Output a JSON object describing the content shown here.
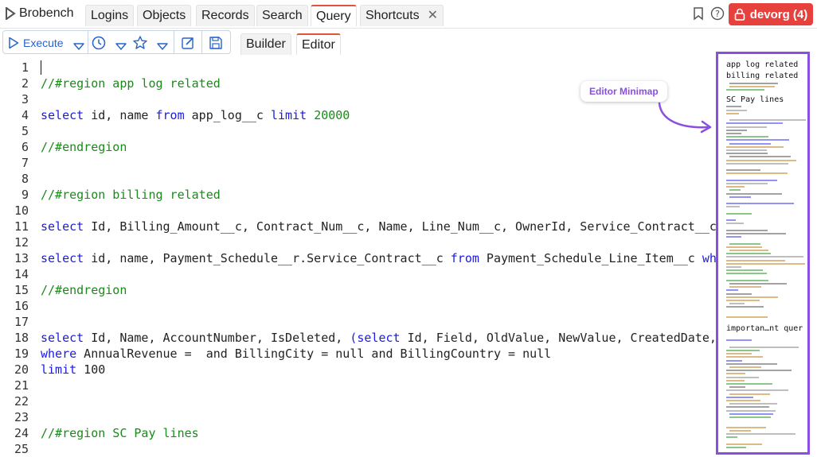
{
  "app": {
    "name": "Brobench"
  },
  "nav_tabs": [
    {
      "label": "Logins",
      "active": false
    },
    {
      "label": "Objects",
      "active": false
    },
    {
      "label": "Records",
      "active": false
    },
    {
      "label": "Search",
      "active": false
    },
    {
      "label": "Query",
      "active": true
    },
    {
      "label": "Shortcuts",
      "active": false,
      "closable": true
    }
  ],
  "header_icons": [
    "bookmark-icon",
    "help-icon"
  ],
  "org_button": {
    "label": "devorg (4)",
    "icon": "lock-icon",
    "color": "#e6413c"
  },
  "toolbar": {
    "execute_label": "Execute",
    "icons": [
      "play-icon",
      "chevron-down-icon",
      "history-icon",
      "chevron-down-icon",
      "star-icon",
      "chevron-down-icon",
      "edit-icon",
      "save-icon"
    ]
  },
  "sub_tabs": [
    {
      "label": "Builder",
      "active": false
    },
    {
      "label": "Editor",
      "active": true
    }
  ],
  "editor": {
    "line_numbers": [
      "1",
      "2",
      "3",
      "4",
      "5",
      "6",
      "7",
      "8",
      "9",
      "10",
      "11",
      "12",
      "13",
      "14",
      "15",
      "16",
      "17",
      "18",
      "19",
      "20",
      "21",
      "22",
      "23",
      "24",
      "25"
    ],
    "lines": [
      {
        "n": 1,
        "tokens": []
      },
      {
        "n": 2,
        "tokens": [
          {
            "t": "//#region app log related",
            "c": "cm"
          }
        ]
      },
      {
        "n": 3,
        "tokens": []
      },
      {
        "n": 4,
        "tokens": [
          {
            "t": "select",
            "c": "kw"
          },
          {
            "t": " id, name ",
            "c": ""
          },
          {
            "t": "from",
            "c": "kw"
          },
          {
            "t": " app_log__c ",
            "c": ""
          },
          {
            "t": "limit",
            "c": "kw"
          },
          {
            "t": " ",
            "c": ""
          },
          {
            "t": "20000",
            "c": "num"
          }
        ]
      },
      {
        "n": 5,
        "tokens": []
      },
      {
        "n": 6,
        "tokens": [
          {
            "t": "//#endregion",
            "c": "cm"
          }
        ]
      },
      {
        "n": 7,
        "tokens": []
      },
      {
        "n": 8,
        "tokens": []
      },
      {
        "n": 9,
        "tokens": [
          {
            "t": "//#region billing related",
            "c": "cm"
          }
        ]
      },
      {
        "n": 10,
        "tokens": []
      },
      {
        "n": 11,
        "tokens": [
          {
            "t": "select",
            "c": "kw"
          },
          {
            "t": " Id, Billing_Amount__c, Contract_Num__c, Name, Line_Num__c, OwnerId, Service_Contract__c,",
            "c": ""
          }
        ]
      },
      {
        "n": 12,
        "tokens": []
      },
      {
        "n": 13,
        "tokens": [
          {
            "t": "select",
            "c": "kw"
          },
          {
            "t": " id, name, Payment_Schedule__r.Service_Contract__c ",
            "c": ""
          },
          {
            "t": "from",
            "c": "kw"
          },
          {
            "t": " Payment_Schedule_Line_Item__c ",
            "c": ""
          },
          {
            "t": "whe",
            "c": "kw"
          }
        ]
      },
      {
        "n": 14,
        "tokens": []
      },
      {
        "n": 15,
        "tokens": [
          {
            "t": "//#endregion",
            "c": "cm"
          }
        ]
      },
      {
        "n": 16,
        "tokens": []
      },
      {
        "n": 17,
        "tokens": []
      },
      {
        "n": 18,
        "tokens": [
          {
            "t": "select",
            "c": "kw"
          },
          {
            "t": " Id, Name, AccountNumber, IsDeleted, ",
            "c": ""
          },
          {
            "t": "(select",
            "c": "kw"
          },
          {
            "t": " Id, Field, OldValue, NewValue, CreatedDate,",
            "c": ""
          }
        ]
      },
      {
        "n": 19,
        "tokens": [
          {
            "t": "where",
            "c": "kw"
          },
          {
            "t": " AnnualRevenue =  and BillingCity = null and BillingCountry = null",
            "c": ""
          }
        ]
      },
      {
        "n": 20,
        "tokens": [
          {
            "t": "limit",
            "c": "kw"
          },
          {
            "t": " 100",
            "c": ""
          }
        ]
      },
      {
        "n": 21,
        "tokens": []
      },
      {
        "n": 22,
        "tokens": []
      },
      {
        "n": 23,
        "tokens": []
      },
      {
        "n": 24,
        "tokens": [
          {
            "t": "//#region SC Pay lines",
            "c": "cm"
          }
        ]
      },
      {
        "n": 25,
        "tokens": []
      }
    ]
  },
  "minimap": {
    "headings": [
      "app log related",
      "billing related",
      "SC Pay lines",
      "importan…nt quer"
    ],
    "border_color": "#8a4fe0"
  },
  "callout": {
    "label": "Editor Minimap",
    "color": "#8a4fe0"
  }
}
